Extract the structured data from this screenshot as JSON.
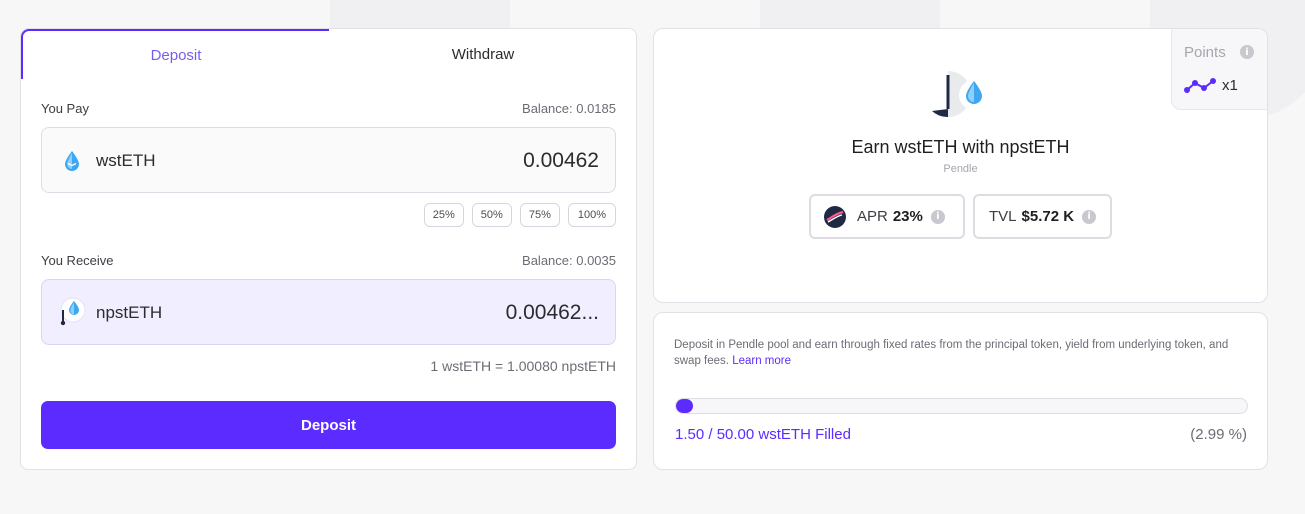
{
  "tabs": {
    "deposit": "Deposit",
    "withdraw": "Withdraw"
  },
  "pay": {
    "label": "You Pay",
    "balance": "Balance: 0.0185",
    "token": "wstETH",
    "amount": "0.00462",
    "percent_options": [
      "25%",
      "50%",
      "75%",
      "100%"
    ]
  },
  "receive": {
    "label": "You Receive",
    "balance": "Balance: 0.0035",
    "token": "npstETH",
    "amount": "0.00462..."
  },
  "rate": "1 wstETH = 1.00080 npstETH",
  "deposit_button": "Deposit",
  "points": {
    "label": "Points",
    "multiplier": "x1"
  },
  "pool": {
    "title": "Earn wstETH with npstETH",
    "protocol": "Pendle",
    "apr_label": "APR",
    "apr_value": "23%",
    "tvl_label": "TVL",
    "tvl_value": "$5.72 K"
  },
  "info": {
    "description": "Deposit in Pendle pool and earn through fixed rates from the principal token, yield from underlying token, and swap fees.",
    "learn_more": "Learn more",
    "filled_text": "1.50 / 50.00 wstETH Filled",
    "filled_percent": "(2.99 %)",
    "progress_fraction": 0.0299
  },
  "colors": {
    "accent": "#5b2bff",
    "accent_light": "#f1efff",
    "token_blue": "#3fa7f0"
  },
  "icons": {
    "info": "info-icon",
    "wsteth": "wsteth-droplet-icon",
    "npsteth": "npsteth-token-icon",
    "points": "points-nodes-icon",
    "pendle": "pendle-logo-icon"
  }
}
